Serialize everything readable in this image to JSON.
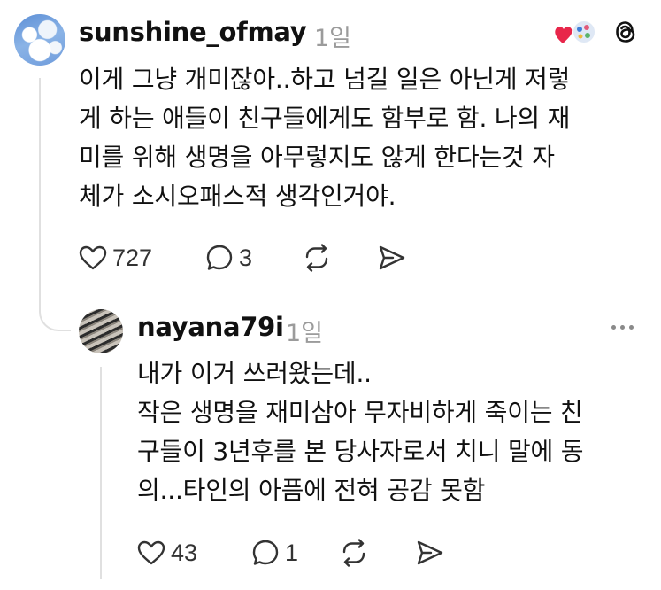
{
  "comments": [
    {
      "username": "sunshine_ofmay",
      "time": "1일",
      "lines": [
        "이게 그냥 개미잖아..하고 넘길 일은 아닌게 저렇",
        "게 하는 애들이 친구들에게도 함부로 함. 나의 재",
        "미를 위해 생명을 아무렇지도 않게 한다는것 자",
        "체가 소시오패스적 생각인거야."
      ],
      "likes": "727",
      "replies": "3",
      "icons": [
        "heart-icon",
        "comment-icon",
        "repost-icon",
        "share-icon",
        "threads-logo-icon"
      ]
    },
    {
      "username": "nayana79i",
      "time": "1일",
      "lines": [
        "내가 이거 쓰러왔는데..",
        "작은 생명을 재미삼아 무자비하게 죽이는 친",
        "구들이 3년후를 본 당사자로서 치니 말에 동",
        "의...타인의 아픔에 전혀 공감 못함"
      ],
      "likes": "43",
      "replies": "1",
      "icons": [
        "heart-icon",
        "comment-icon",
        "repost-icon",
        "share-icon",
        "more-icon"
      ]
    }
  ],
  "colors": {
    "text": "#111111",
    "muted": "#9b9b9b",
    "thread_line": "#e0e0e0",
    "liked_heart": "#e8264a"
  }
}
